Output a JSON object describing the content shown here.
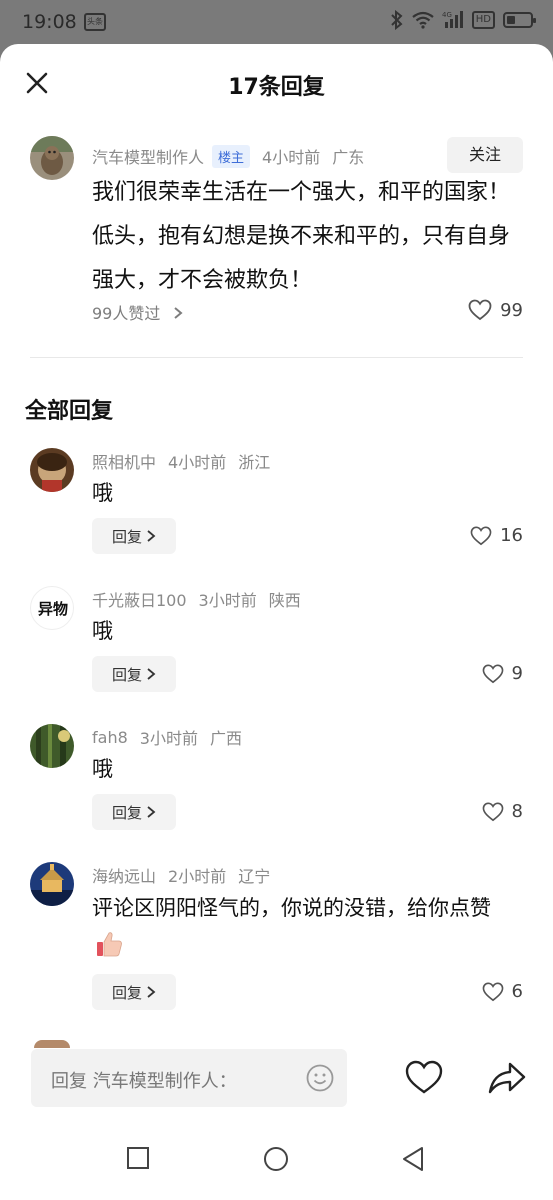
{
  "status": {
    "time": "19:08",
    "app_badge": "头条",
    "hd": "HD",
    "network": "4G"
  },
  "header": {
    "title": "17条回复"
  },
  "main_comment": {
    "author": "汽车模型制作人",
    "badge": "楼主",
    "time": "4小时前",
    "location": "广东",
    "follow_label": "关注",
    "text": "我们很荣幸生活在一个强大，和平的国家！低头，抱有幻想是换不来和平的，只有自身强大，才不会被欺负！",
    "likes_link": "99人赞过",
    "like_count": "99"
  },
  "section_title": "全部回复",
  "replies": [
    {
      "author": "照相机中",
      "time": "4小时前",
      "location": "浙江",
      "text": "哦",
      "reply_label": "回复",
      "like_count": "16"
    },
    {
      "author": "千光蔽日100",
      "time": "3小时前",
      "location": "陕西",
      "text": "哦",
      "reply_label": "回复",
      "like_count": "9",
      "avatar_text": "异物"
    },
    {
      "author": "fah8",
      "time": "3小时前",
      "location": "广西",
      "text": "哦",
      "reply_label": "回复",
      "like_count": "8"
    },
    {
      "author": "海纳远山",
      "time": "2小时前",
      "location": "辽宁",
      "text": "评论区阴阳怪气的，你说的没错，给你点赞",
      "reply_label": "回复",
      "like_count": "6"
    }
  ],
  "input": {
    "placeholder": "回复 汽车模型制作人："
  },
  "colors": {
    "badge_bg": "#e8f0fd",
    "badge_text": "#3f6ed8",
    "scrim": "#7a7a7a"
  }
}
